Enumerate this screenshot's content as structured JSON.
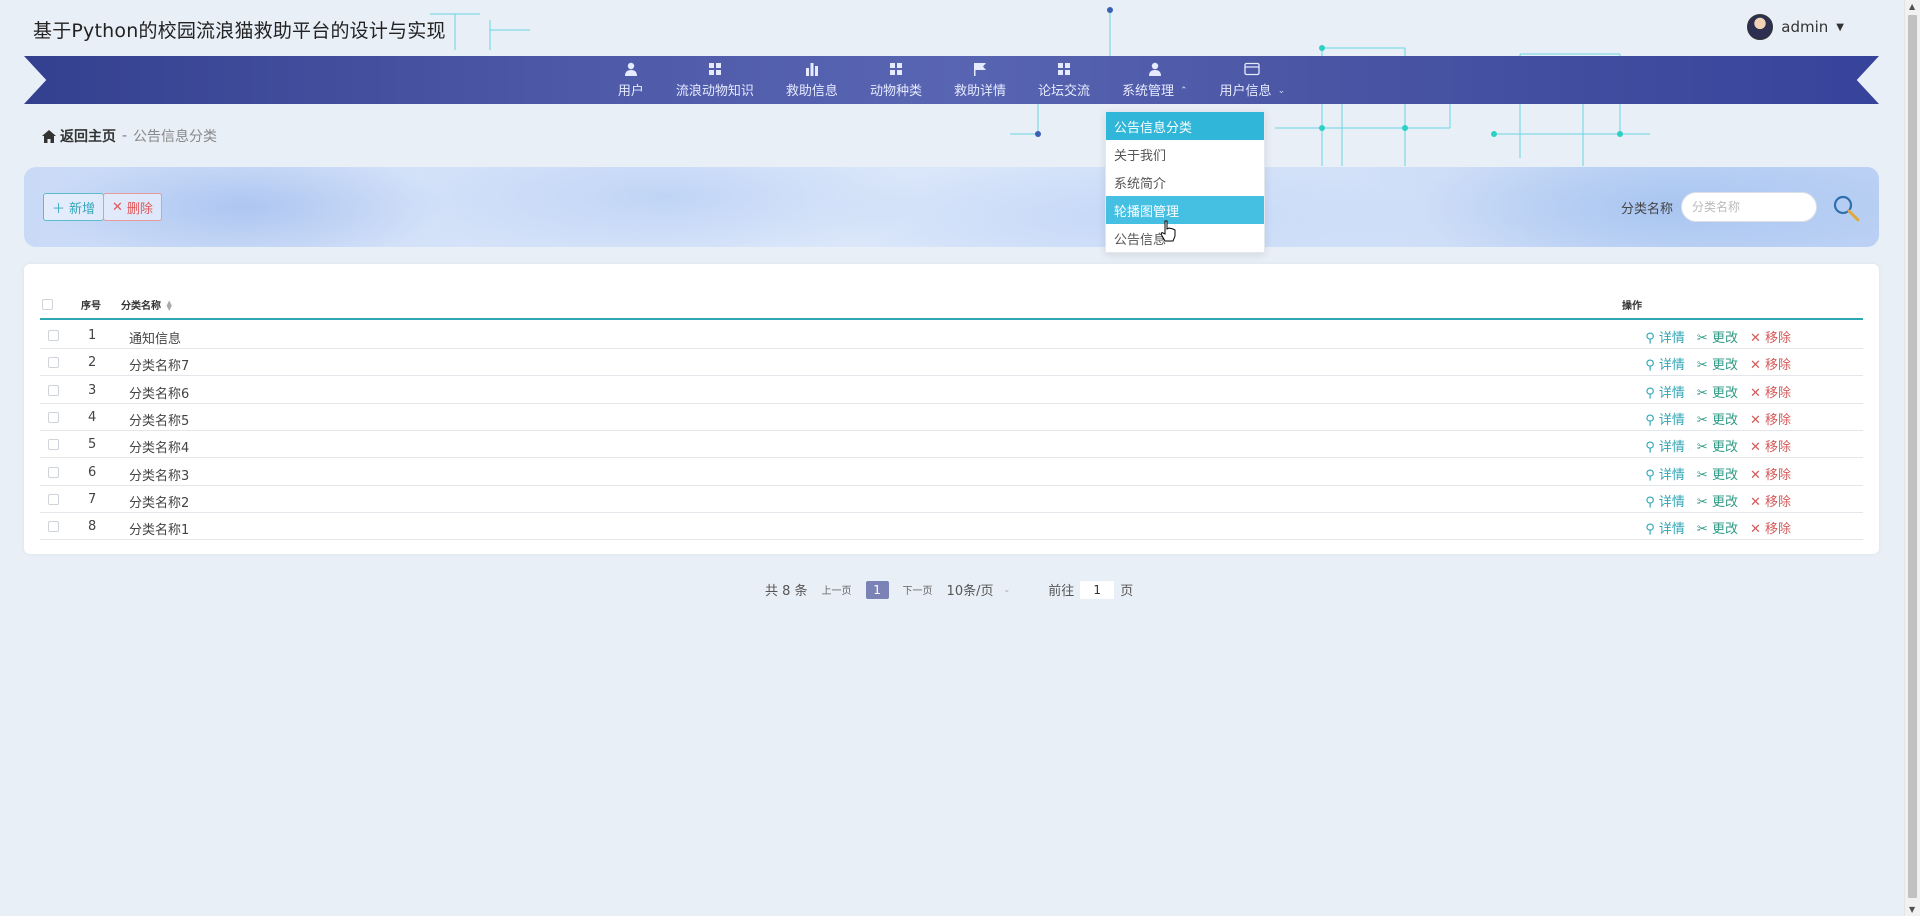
{
  "header": {
    "title": "基于Python的校园流浪猫救助平台的设计与实现",
    "user": "admin"
  },
  "nav": {
    "items": [
      {
        "label": "用户",
        "icon": "user-icon"
      },
      {
        "label": "流浪动物知识",
        "icon": "grid-icon"
      },
      {
        "label": "救助信息",
        "icon": "bar-chart-icon"
      },
      {
        "label": "动物种类",
        "icon": "grid-icon"
      },
      {
        "label": "救助详情",
        "icon": "flag-icon"
      },
      {
        "label": "论坛交流",
        "icon": "grid-icon"
      },
      {
        "label": "系统管理",
        "icon": "user-icon"
      },
      {
        "label": "用户信息",
        "icon": "card-icon"
      }
    ]
  },
  "dropdown": {
    "items": [
      {
        "label": "公告信息分类",
        "state": "active"
      },
      {
        "label": "关于我们",
        "state": "normal"
      },
      {
        "label": "系统简介",
        "state": "normal"
      },
      {
        "label": "轮播图管理",
        "state": "hover"
      },
      {
        "label": "公告信息",
        "state": "normal"
      }
    ]
  },
  "breadcrumb": {
    "home": "返回主页",
    "separator": "-",
    "current": "公告信息分类"
  },
  "toolbar": {
    "add_label": "新增",
    "delete_label": "删除",
    "search_label": "分类名称",
    "search_placeholder": "分类名称"
  },
  "table": {
    "headers": {
      "index": "序号",
      "name": "分类名称",
      "ops": "操作"
    },
    "actions": {
      "detail": "详情",
      "edit": "更改",
      "remove": "移除"
    },
    "rows": [
      {
        "index": "1",
        "name": "通知信息"
      },
      {
        "index": "2",
        "name": "分类名称7"
      },
      {
        "index": "3",
        "name": "分类名称6"
      },
      {
        "index": "4",
        "name": "分类名称5"
      },
      {
        "index": "5",
        "name": "分类名称4"
      },
      {
        "index": "6",
        "name": "分类名称3"
      },
      {
        "index": "7",
        "name": "分类名称2"
      },
      {
        "index": "8",
        "name": "分类名称1"
      }
    ]
  },
  "pagination": {
    "total": "共 8 条",
    "prev": "上一页",
    "current": "1",
    "next": "下一页",
    "page_size": "10条/页",
    "goto": "前往",
    "goto_value": "1",
    "page_unit": "页"
  },
  "colors": {
    "nav": "#4a56a4",
    "accent": "#2fa6b4",
    "danger": "#e0585a",
    "dropdown_active": "#2fb6d9"
  }
}
